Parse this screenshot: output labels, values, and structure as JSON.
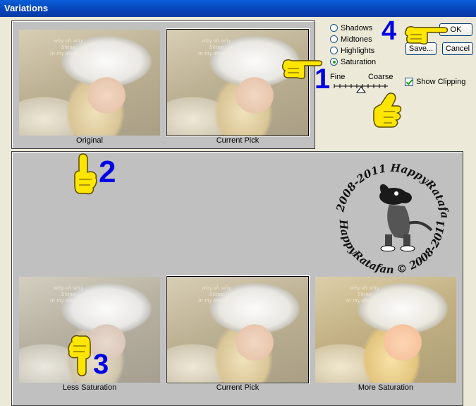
{
  "window": {
    "title": "Variations"
  },
  "top_panel": {
    "thumbs": [
      {
        "label": "Original",
        "caption": "why oh why\nShine\nin my dreams?"
      },
      {
        "label": "Current Pick",
        "caption": "why oh why\nShine\nin my dreams?"
      }
    ]
  },
  "controls": {
    "radios": [
      {
        "label": "Shadows",
        "selected": false
      },
      {
        "label": "Midtones",
        "selected": false
      },
      {
        "label": "Highlights",
        "selected": false
      },
      {
        "label": "Saturation",
        "selected": true
      }
    ],
    "slider": {
      "left_label": "Fine",
      "right_label": "Coarse"
    },
    "show_clipping": {
      "label": "Show Clipping",
      "checked": true
    },
    "buttons": {
      "ok": "OK",
      "save": "Save...",
      "cancel": "Cancel"
    }
  },
  "bottom_panel": {
    "thumbs": [
      {
        "label": "Less Saturation",
        "caption": "why oh why\nShine\nin my dreams?"
      },
      {
        "label": "Current Pick",
        "caption": "why oh why\nShine\nin my dreams?"
      },
      {
        "label": "More Saturation",
        "caption": "why oh why\nShine\nin my dreams?"
      }
    ]
  },
  "annotations": {
    "n1": "1",
    "n2": "2",
    "n3": "3",
    "n4": "4"
  },
  "watermark": {
    "top": "© 2008-2011  HappyRatafan",
    "bottom": "HappyRatafan © 2008-2011"
  },
  "colors": {
    "accent": "#0000e6",
    "hand": "#ffe600",
    "title_bar": "#0a5fd8"
  }
}
